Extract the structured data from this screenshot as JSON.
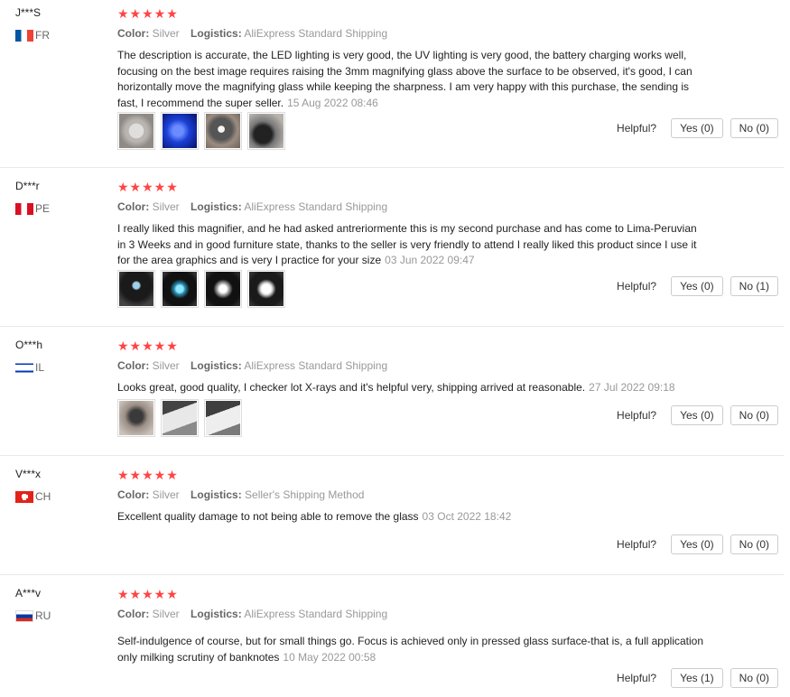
{
  "labels": {
    "color": "Color:",
    "logistics": "Logistics:",
    "helpful": "Helpful?"
  },
  "reviews": [
    {
      "user": "J***S",
      "country": "FR",
      "stars": "★★★★★",
      "color": "Silver",
      "logistics": "AliExpress Standard Shipping",
      "text": "The description is accurate, the LED lighting is very good, the UV lighting is very good, the battery charging works well, focusing on the best image requires raising the 3mm magnifying glass above the surface to be observed, it's good, I can horizontally move the magnifying glass while keeping the sharpness. I am very happy with this purchase, the sending is fast, I recommend the super seller.",
      "date": "15 Aug 2022 08:46",
      "yes": "Yes (0)",
      "no": "No (0)"
    },
    {
      "user": "D***r",
      "country": "PE",
      "stars": "★★★★★",
      "color": "Silver",
      "logistics": "AliExpress Standard Shipping",
      "text": "I really liked this magnifier, and he had asked antreriormente this is my second purchase and has come to Lima-Peruvian in 3 Weeks and in good furniture state, thanks to the seller is very friendly to attend I really liked this product since I use it for the area graphics and is very I practice for your size",
      "date": "03 Jun 2022 09:47",
      "yes": "Yes (0)",
      "no": "No (1)"
    },
    {
      "user": "O***h",
      "country": "IL",
      "stars": "★★★★★",
      "color": "Silver",
      "logistics": "AliExpress Standard Shipping",
      "text": "Looks great, good quality, I checker lot X-rays and it's helpful very, shipping arrived at reasonable.",
      "date": "27 Jul 2022 09:18",
      "yes": "Yes (0)",
      "no": "No (0)"
    },
    {
      "user": "V***x",
      "country": "CH",
      "stars": "★★★★★",
      "color": "Silver",
      "logistics": "Seller's Shipping Method",
      "text": "Excellent quality damage to not being able to remove the glass",
      "date": "03 Oct 2022 18:42",
      "yes": "Yes (0)",
      "no": "No (0)"
    },
    {
      "user": "A***v",
      "country": "RU",
      "stars": "★★★★★",
      "color": "Silver",
      "logistics": "AliExpress Standard Shipping",
      "text": "Self-indulgence of course, but for small things go. Focus is achieved only in pressed glass surface-that is, a full application only milking scrutiny of banknotes",
      "date": "10 May 2022 00:58",
      "yes": "Yes (1)",
      "no": "No (0)"
    }
  ]
}
